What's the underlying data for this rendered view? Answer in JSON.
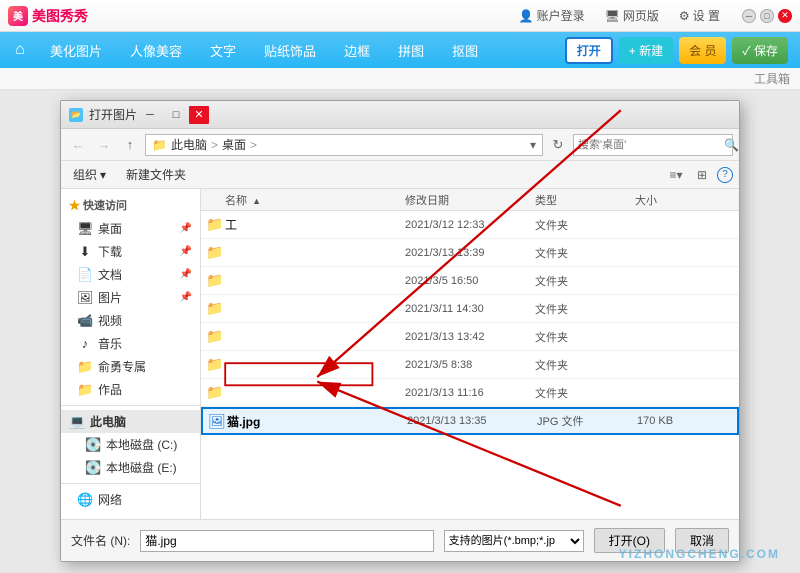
{
  "app": {
    "title": "美图秀秀",
    "account": "账户登录",
    "web_version": "网页版",
    "settings": "设 置",
    "toolbox": "工具箱"
  },
  "nav": {
    "home_icon": "⌂",
    "items": [
      {
        "label": "美化图片",
        "id": "beautify"
      },
      {
        "label": "人像美容",
        "id": "beauty"
      },
      {
        "label": "文字",
        "id": "text"
      },
      {
        "label": "贴纸饰品",
        "id": "stickers"
      },
      {
        "label": "边框",
        "id": "border"
      },
      {
        "label": "拼图",
        "id": "mosaic"
      },
      {
        "label": "抠图",
        "id": "cutout"
      }
    ],
    "btn_open": "打开",
    "btn_new": "+ 新建",
    "btn_vip": "会 员",
    "btn_save": "✓ 保存"
  },
  "dialog": {
    "title": "打开图片",
    "breadcrumb": {
      "pc": "此电脑",
      "separator": ">",
      "desktop": "桌面",
      "sep2": ">"
    },
    "search_placeholder": "搜索'桌面'",
    "toolbar": {
      "organize": "组织",
      "new_folder": "新建文件夹",
      "dropdown_arrow": "▾"
    },
    "sidebar": {
      "quick_access": "快速访问",
      "items": [
        {
          "label": "桌面",
          "icon": "🖥",
          "id": "desktop"
        },
        {
          "label": "下载",
          "icon": "⬇",
          "id": "download"
        },
        {
          "label": "文档",
          "icon": "📄",
          "id": "documents"
        },
        {
          "label": "图片",
          "icon": "🖼",
          "id": "pictures"
        },
        {
          "label": "视频",
          "icon": "📹",
          "id": "videos"
        },
        {
          "label": "音乐",
          "icon": "♪",
          "id": "music"
        },
        {
          "label": "俞勇专属",
          "icon": "📁",
          "id": "special"
        },
        {
          "label": "作品",
          "icon": "📁",
          "id": "works"
        }
      ],
      "this_pc": "此电脑",
      "this_pc_items": [
        {
          "label": "本地磁盘 (C:)",
          "icon": "💻",
          "id": "c_drive"
        },
        {
          "label": "本地磁盘 (E:)",
          "icon": "💻",
          "id": "e_drive"
        }
      ],
      "network": "网络"
    },
    "file_list": {
      "columns": [
        "名称",
        "修改日期",
        "类型",
        "大小"
      ],
      "files": [
        {
          "name": "工",
          "date": "2021/3/12 12:33",
          "type": "文件夹",
          "size": "",
          "is_folder": true
        },
        {
          "name": "",
          "date": "2021/3/13 13:39",
          "type": "文件夹",
          "size": "",
          "is_folder": true
        },
        {
          "name": "",
          "date": "2021/3/5 16:50",
          "type": "文件夹",
          "size": "",
          "is_folder": true
        },
        {
          "name": "",
          "date": "2021/3/11 14:30",
          "type": "文件夹",
          "size": "",
          "is_folder": true
        },
        {
          "name": "",
          "date": "2021/3/13 13:42",
          "type": "文件夹",
          "size": "",
          "is_folder": true
        },
        {
          "name": "",
          "date": "2021/3/5 8:38",
          "type": "文件夹",
          "size": "",
          "is_folder": true
        },
        {
          "name": "",
          "date": "2021/3/13 11:16",
          "type": "文件夹",
          "size": "",
          "is_folder": true
        },
        {
          "name": "猫.jpg",
          "date": "2021/3/13 13:35",
          "type": "JPG 文件",
          "size": "170 KB",
          "is_folder": false,
          "selected": true
        }
      ]
    },
    "bottom": {
      "filename_label": "文件名 (N):",
      "filename_value": "猫.jpg",
      "filetype_label": "支持的图片(*.bmp;*.jp",
      "ok_btn": "打开(O)",
      "cancel_btn": "取消"
    }
  },
  "icons": {
    "search": "🔍",
    "gear": "⚙",
    "monitor": "🖥",
    "folder_yellow": "📁",
    "file_image": "🖼",
    "arrow_left": "←",
    "arrow_right": "→",
    "arrow_up": "↑",
    "refresh": "↻",
    "close": "✕",
    "minimize": "─",
    "maximize": "□",
    "chevron_down": "▾",
    "view_list": "≡",
    "view_grid": "⊞",
    "help": "?"
  },
  "watermark": "YIZHONGCHENG.COM"
}
